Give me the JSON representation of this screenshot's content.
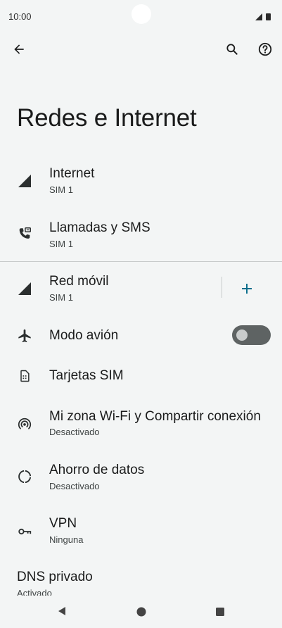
{
  "status_bar": {
    "time": "10:00"
  },
  "page": {
    "title": "Redes e Internet"
  },
  "items": [
    {
      "title": "Internet",
      "subtitle": "SIM 1",
      "icon": "signal-icon"
    },
    {
      "title": "Llamadas y SMS",
      "subtitle": "SIM 1",
      "icon": "calls-sms-icon"
    },
    {
      "title": "Red móvil",
      "subtitle": "SIM 1",
      "icon": "signal-icon"
    },
    {
      "title": "Modo avión",
      "subtitle": "",
      "icon": "airplane-icon",
      "toggle": "off"
    },
    {
      "title": "Tarjetas SIM",
      "subtitle": "",
      "icon": "sim-card-icon"
    },
    {
      "title": "Mi zona Wi-Fi y Compartir conexión",
      "subtitle": "Desactivado",
      "icon": "hotspot-icon"
    },
    {
      "title": "Ahorro de datos",
      "subtitle": "Desactivado",
      "icon": "data-saver-icon"
    },
    {
      "title": "VPN",
      "subtitle": "Ninguna",
      "icon": "vpn-key-icon"
    },
    {
      "title": "DNS privado",
      "subtitle": "Activado",
      "icon": ""
    }
  ],
  "colors": {
    "accent": "#0b6e8c",
    "background": "#f3f5f5",
    "switch_track": "#5e6363"
  }
}
